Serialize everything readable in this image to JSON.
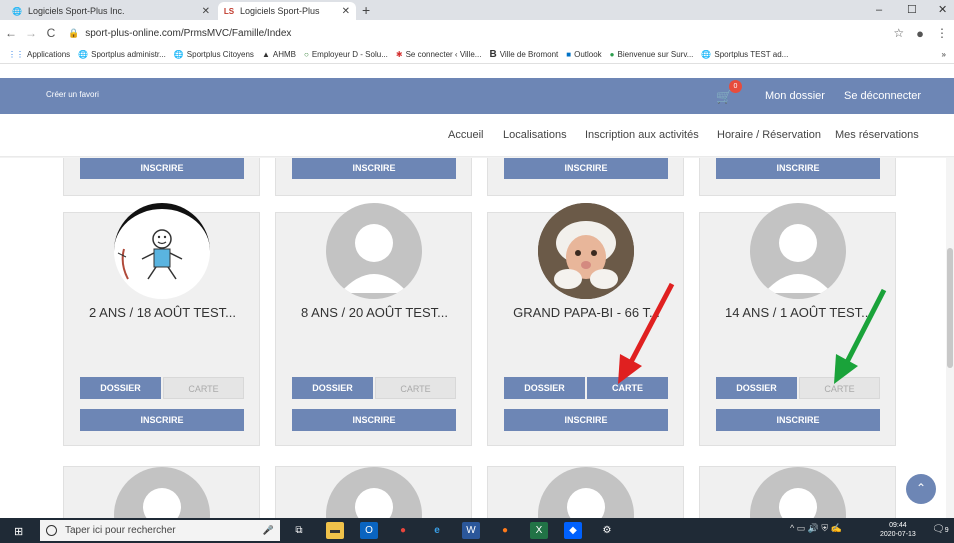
{
  "browser": {
    "tabs": [
      {
        "title": "Logiciels Sport-Plus Inc.",
        "active": false,
        "icon": "globe-icon"
      },
      {
        "title": "Logiciels Sport-Plus",
        "active": true,
        "icon": "sp-logo-icon"
      }
    ],
    "new_tab": "+",
    "window_controls": [
      "–",
      "☐",
      "✕"
    ],
    "url": "sport-plus-online.com/PrmsMVC/Famille/Index",
    "bookmarks": [
      {
        "label": "Applications",
        "icon": "apps-grid-icon"
      },
      {
        "label": "Sportplus administr...",
        "icon": "globe-icon"
      },
      {
        "label": "Sportplus Citoyens",
        "icon": "globe-icon"
      },
      {
        "label": "AHMB",
        "icon": "ahmb-icon"
      },
      {
        "label": "Employeur D - Solu...",
        "icon": "circle-icon"
      },
      {
        "label": "Se connecter ‹ Ville...",
        "icon": "asterisk-icon"
      },
      {
        "label": "Ville de Bromont",
        "icon": "b-icon"
      },
      {
        "label": "Outlook",
        "icon": "outlook-icon"
      },
      {
        "label": "Bienvenue sur Surv...",
        "icon": "survey-icon"
      },
      {
        "label": "Sportplus TEST ad...",
        "icon": "globe-icon"
      }
    ],
    "bookmarks_more": "»"
  },
  "header": {
    "fav_link": "Créer un favori",
    "cart_count": "0",
    "my_file": "Mon dossier",
    "logout": "Se déconnecter",
    "color": "#6d86b5"
  },
  "nav": {
    "items": [
      "Accueil",
      "Localisations",
      "Inscription aux activités",
      "Horaire / Réservation",
      "Mes réservations"
    ]
  },
  "buttons": {
    "register": "INSCRIRE",
    "file": "DOSSIER",
    "card": "CARTE"
  },
  "members": [
    {
      "name": "2 ANS / 18 AOÛT TEST...",
      "avatar": "child-drawing",
      "card_enabled": false
    },
    {
      "name": "8 ANS / 20 AOÛT TEST...",
      "avatar": "placeholder",
      "card_enabled": false
    },
    {
      "name": "GRAND PAPA-BI - 66 T...",
      "avatar": "photo",
      "card_enabled": true
    },
    {
      "name": "14 ANS / 1 AOÛT TEST...",
      "avatar": "placeholder",
      "card_enabled": false
    }
  ],
  "annotations": [
    {
      "color": "#e02020",
      "target": "carte-enabled"
    },
    {
      "color": "#1aa33a",
      "target": "carte-disabled"
    }
  ],
  "taskbar": {
    "search_placeholder": "Taper ici pour rechercher",
    "time": "09:44",
    "date": "2020-07-13",
    "notif_count": "9"
  }
}
